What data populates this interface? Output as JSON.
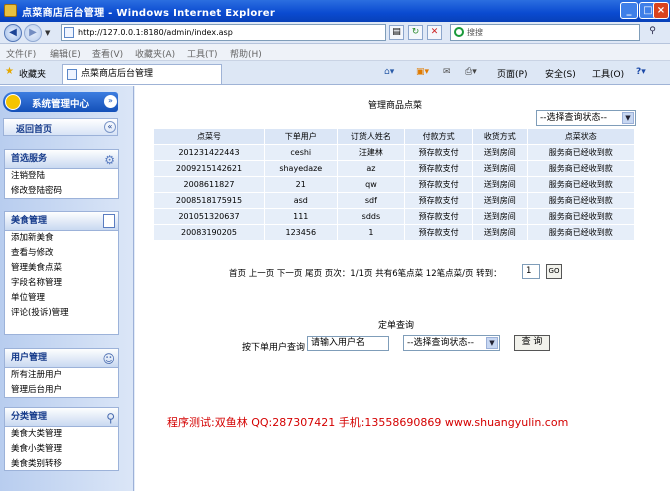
{
  "window": {
    "title": "点菜商店后台管理 - Windows Internet Explorer",
    "min_label": "_",
    "max_label": "□",
    "close_label": "×"
  },
  "address": {
    "back_glyph": "◀",
    "forward_glyph": "▶",
    "url": "http://127.0.0.1:8180/admin/index.asp",
    "search_placeholder": "搜搜"
  },
  "menu": {
    "items": [
      "文件(F)",
      "编辑(E)",
      "查看(V)",
      "收藏夹(A)",
      "工具(T)",
      "帮助(H)"
    ]
  },
  "tabs": {
    "favorites_label": "收藏夹",
    "tab_title": "点菜商店后台管理",
    "tools": [
      "页面(P)",
      "安全(S)",
      "工具(O)"
    ]
  },
  "sidebar": {
    "header_title": "系统管理中心",
    "home_label": "返回首页",
    "panels": [
      {
        "title": "首选服务",
        "icon": "gear-icon",
        "items": [
          "注销登陆",
          "修改登陆密码"
        ]
      },
      {
        "title": "美食管理",
        "icon": "document-icon",
        "items": [
          "添加新美食",
          "查看与修改",
          "管理美食点菜",
          "字段名称管理",
          "单位管理",
          "评论(投诉)管理"
        ]
      },
      {
        "title": "用户管理",
        "icon": "users-icon",
        "items": [
          "所有注册用户",
          "管理后台用户"
        ]
      },
      {
        "title": "分类管理",
        "icon": "search-icon",
        "items": [
          "美食大类管理",
          "美食小类管理",
          "美食类别转移"
        ]
      }
    ]
  },
  "main": {
    "title": "管理商品点菜",
    "status_filter": "--选择查询状态--",
    "table": {
      "headers": [
        "点菜号",
        "下单用户",
        "订货人姓名",
        "付款方式",
        "收货方式",
        "点菜状态"
      ],
      "rows": [
        [
          "201231422443",
          "ceshi",
          "汪建林",
          "预存款支付",
          "送到房间",
          "服务商已经收到款"
        ],
        [
          "2009215142621",
          "shayedaze",
          "az",
          "预存款支付",
          "送到房间",
          "服务商已经收到款"
        ],
        [
          "2008611827",
          "21",
          "qw",
          "预存款支付",
          "送到房间",
          "服务商已经收到款"
        ],
        [
          "2008518175915",
          "asd",
          "sdf",
          "预存款支付",
          "送到房间",
          "服务商已经收到款"
        ],
        [
          "201051320637",
          "111",
          "sdds",
          "预存款支付",
          "送到房间",
          "服务商已经收到款"
        ],
        [
          "20083190205",
          "123456",
          "1",
          "预存款支付",
          "送到房间",
          "服务商已经收到款"
        ]
      ]
    },
    "pagination": {
      "text": "首页 上一页 下一页 尾页 页次：1/1页 共有6笔点菜 12笔点菜/页 转到：",
      "page_value": "1",
      "go_label": "GO"
    },
    "query": {
      "title": "定单查询",
      "label": "按下单用户查询",
      "input_value": "请输入用户名",
      "status_select": "--选择查询状态--",
      "submit_label": "查 询"
    },
    "footer": "程序测试:双鱼林 QQ:287307421 手机:13558690869 www.shuangyulin.com"
  }
}
